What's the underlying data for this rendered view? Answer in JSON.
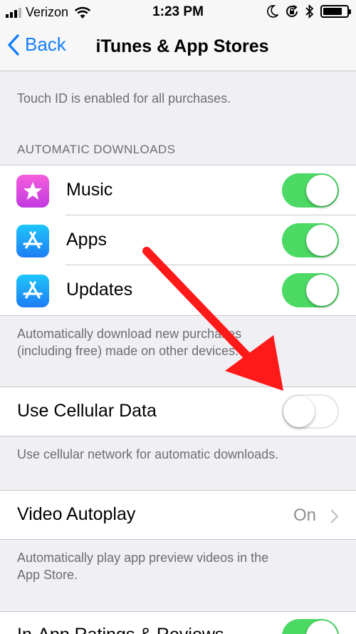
{
  "status_bar": {
    "carrier": "Verizon",
    "time": "1:23 PM",
    "icons": [
      "signal-icon",
      "wifi-icon",
      "moon-icon",
      "rotation-lock-icon",
      "bluetooth-icon",
      "battery-icon"
    ]
  },
  "nav": {
    "back_label": "Back",
    "title": "iTunes & App Stores"
  },
  "touch_id_note": "Touch ID is enabled for all purchases.",
  "automatic_downloads": {
    "header": "AUTOMATIC DOWNLOADS",
    "items": [
      {
        "label": "Music",
        "icon": "star-icon",
        "enabled": true
      },
      {
        "label": "Apps",
        "icon": "app-store-icon",
        "enabled": true
      },
      {
        "label": "Updates",
        "icon": "app-store-icon",
        "enabled": true
      }
    ],
    "footer_line1": "Automatically download new purchases",
    "footer_line2": "(including free) made on other devices."
  },
  "cellular": {
    "label": "Use Cellular Data",
    "enabled": false,
    "footer": "Use cellular network for automatic downloads."
  },
  "video_autoplay": {
    "label": "Video Autoplay",
    "value": "On",
    "footer_line1": "Automatically play app preview videos in the",
    "footer_line2": "App Store."
  },
  "ratings": {
    "label": "In-App Ratings & Reviews",
    "enabled": true
  },
  "colors": {
    "accent": "#147efb",
    "toggle_on": "#4cd964",
    "background": "#efeff4",
    "annotation_arrow": "#ff1a1a"
  }
}
